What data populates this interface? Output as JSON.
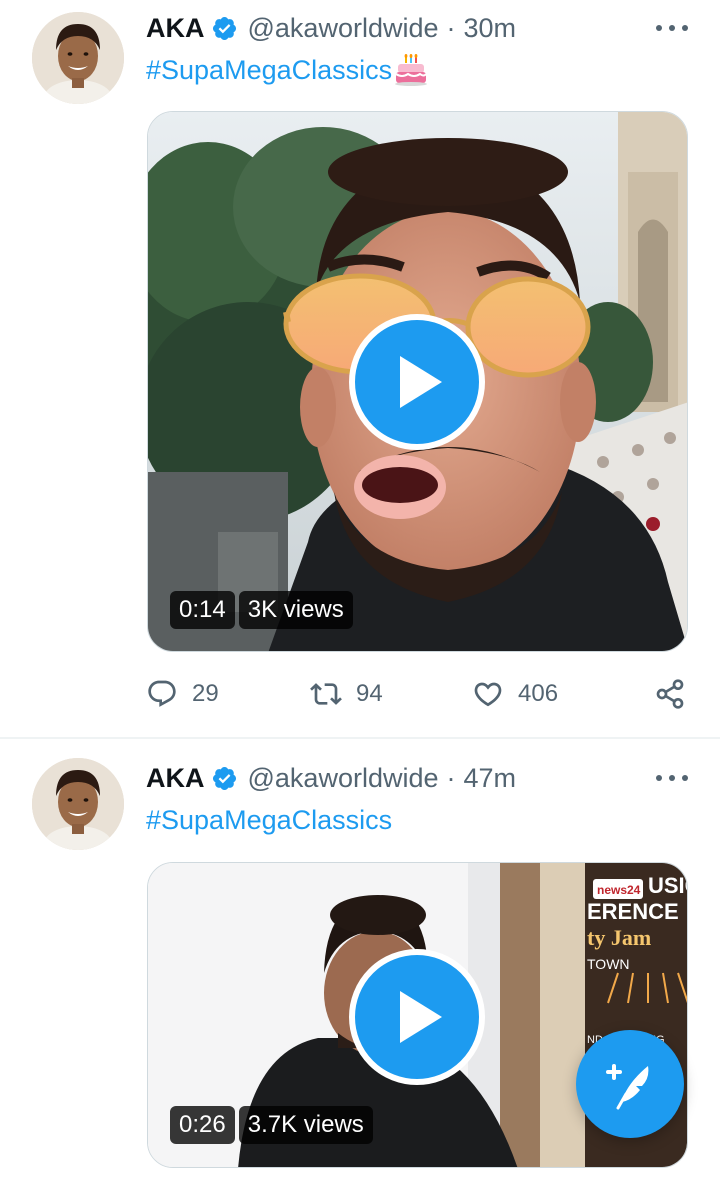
{
  "tweets": [
    {
      "display_name": "AKA",
      "handle": "@akaworldwide",
      "separator": "·",
      "time": "30m",
      "text": "#SupaMegaClassics",
      "emoji_icon": "birthday-cake-icon",
      "video": {
        "duration": "0:14",
        "views": "3K views"
      },
      "stats": {
        "replies": "29",
        "retweets": "94",
        "likes": "406"
      }
    },
    {
      "display_name": "AKA",
      "handle": "@akaworldwide",
      "separator": "·",
      "time": "47m",
      "text": "#SupaMegaClassics",
      "video": {
        "duration": "0:26",
        "views": "3.7K views",
        "backdrop_sign": [
          "news24",
          "USIC",
          "ERENCE",
          "ty Jam",
          "TOWN",
          "ND",
          "NG"
        ]
      }
    }
  ],
  "colors": {
    "accent": "#1d9bf0",
    "secondary_text": "#536471",
    "primary_text": "#0f1419",
    "divider": "#eff3f4"
  },
  "icons": {
    "verified": "verified-badge-icon",
    "more": "more-horizontal-icon",
    "reply": "reply-icon",
    "retweet": "retweet-icon",
    "like": "heart-icon",
    "share": "share-icon",
    "play": "play-icon",
    "compose": "compose-feather-icon"
  }
}
